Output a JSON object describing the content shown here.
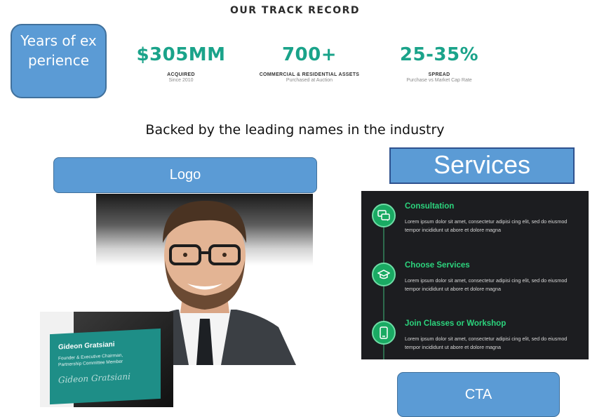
{
  "heading": "OUR TRACK RECORD",
  "years_box": "Years of experience",
  "stats": [
    {
      "value": "$305MM",
      "label": "ACQUIRED",
      "sub": "Since 2010"
    },
    {
      "value": "700+",
      "label": "COMMERCIAL & RESIDENTIAL ASSETS",
      "sub": "Purchased at Auction"
    },
    {
      "value": "25-35%",
      "label": "SPREAD",
      "sub": "Purchase vs Market Cap Rate"
    }
  ],
  "tagline": "Backed by the leading names in the industry",
  "logo_label": "Logo",
  "services_label": "Services",
  "card": {
    "name": "Gideon Gratsiani",
    "role_line1": "Founder & Executive Chairman,",
    "role_line2": "Partnership Committee Member",
    "signature": "Gideon Gratsiani"
  },
  "services": [
    {
      "title": "Consultation",
      "icon": "chat-icon",
      "desc": "Lorem ipsum dolor sit amet, consectetur adipisi cing elit, sed do eiusmod tempor incididunt ut abore et dolore magna"
    },
    {
      "title": "Choose Services",
      "icon": "graduation-cap-icon",
      "desc": "Lorem ipsum dolor sit amet, consectetur adipisi cing elit, sed do eiusmod tempor incididunt ut abore et dolore magna"
    },
    {
      "title": "Join Classes or Workshop",
      "icon": "mobile-icon",
      "desc": "Lorem ipsum dolor sit amet, consectetur adipisi cing elit, sed do eiusmod tempor incididunt ut abore et dolore magna"
    }
  ],
  "cta_label": "CTA",
  "colors": {
    "accent_teal": "#1aa38a",
    "placeholder_blue": "#5b9bd5",
    "service_green": "#2cd47d"
  }
}
